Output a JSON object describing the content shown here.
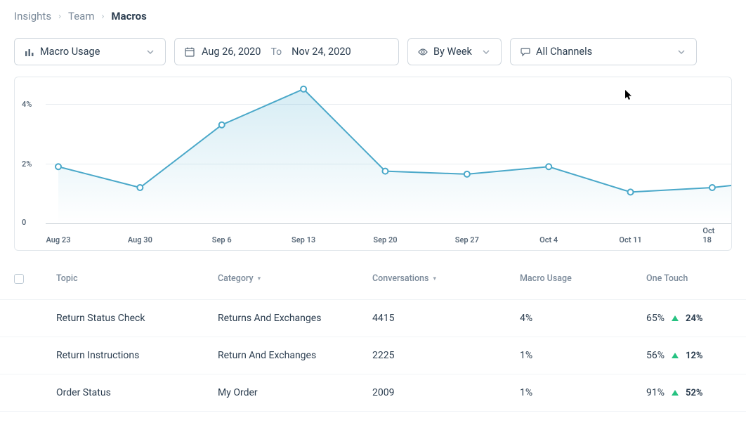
{
  "breadcrumb": {
    "l1": "Insights",
    "l2": "Team",
    "l3": "Macros"
  },
  "filters": {
    "macro": "Macro Usage",
    "date_from": "Aug 26, 2020",
    "date_to_label": "To",
    "date_to": "Nov 24, 2020",
    "group": "By Week",
    "channel": "All Channels"
  },
  "chart_data": {
    "type": "line",
    "categories": [
      "Aug 23",
      "Aug 30",
      "Sep 6",
      "Sep 13",
      "Sep 20",
      "Sep 27",
      "Oct 4",
      "Oct 11",
      "Oct 18"
    ],
    "values": [
      1.9,
      1.2,
      3.3,
      4.5,
      1.75,
      1.65,
      1.9,
      1.05,
      1.2
    ],
    "ylabel": "",
    "ylim": [
      0,
      4.5
    ],
    "yticks": [
      0,
      2,
      4
    ],
    "ytick_labels": [
      "0",
      "2%",
      "4%"
    ]
  },
  "table": {
    "headers": {
      "topic": "Topic",
      "category": "Category",
      "conversations": "Conversations",
      "macro_usage": "Macro Usage",
      "one_touch": "One Touch"
    },
    "rows": [
      {
        "topic": "Return Status Check",
        "category": "Returns And Exchanges",
        "conversations": "4415",
        "macro_usage": "4%",
        "one_touch": "65%",
        "delta": "24%"
      },
      {
        "topic": "Return Instructions",
        "category": "Return And Exchanges",
        "conversations": "2225",
        "macro_usage": "1%",
        "one_touch": "56%",
        "delta": "12%"
      },
      {
        "topic": "Order Status",
        "category": "My Order",
        "conversations": "2009",
        "macro_usage": "1%",
        "one_touch": "91%",
        "delta": "52%"
      }
    ]
  }
}
